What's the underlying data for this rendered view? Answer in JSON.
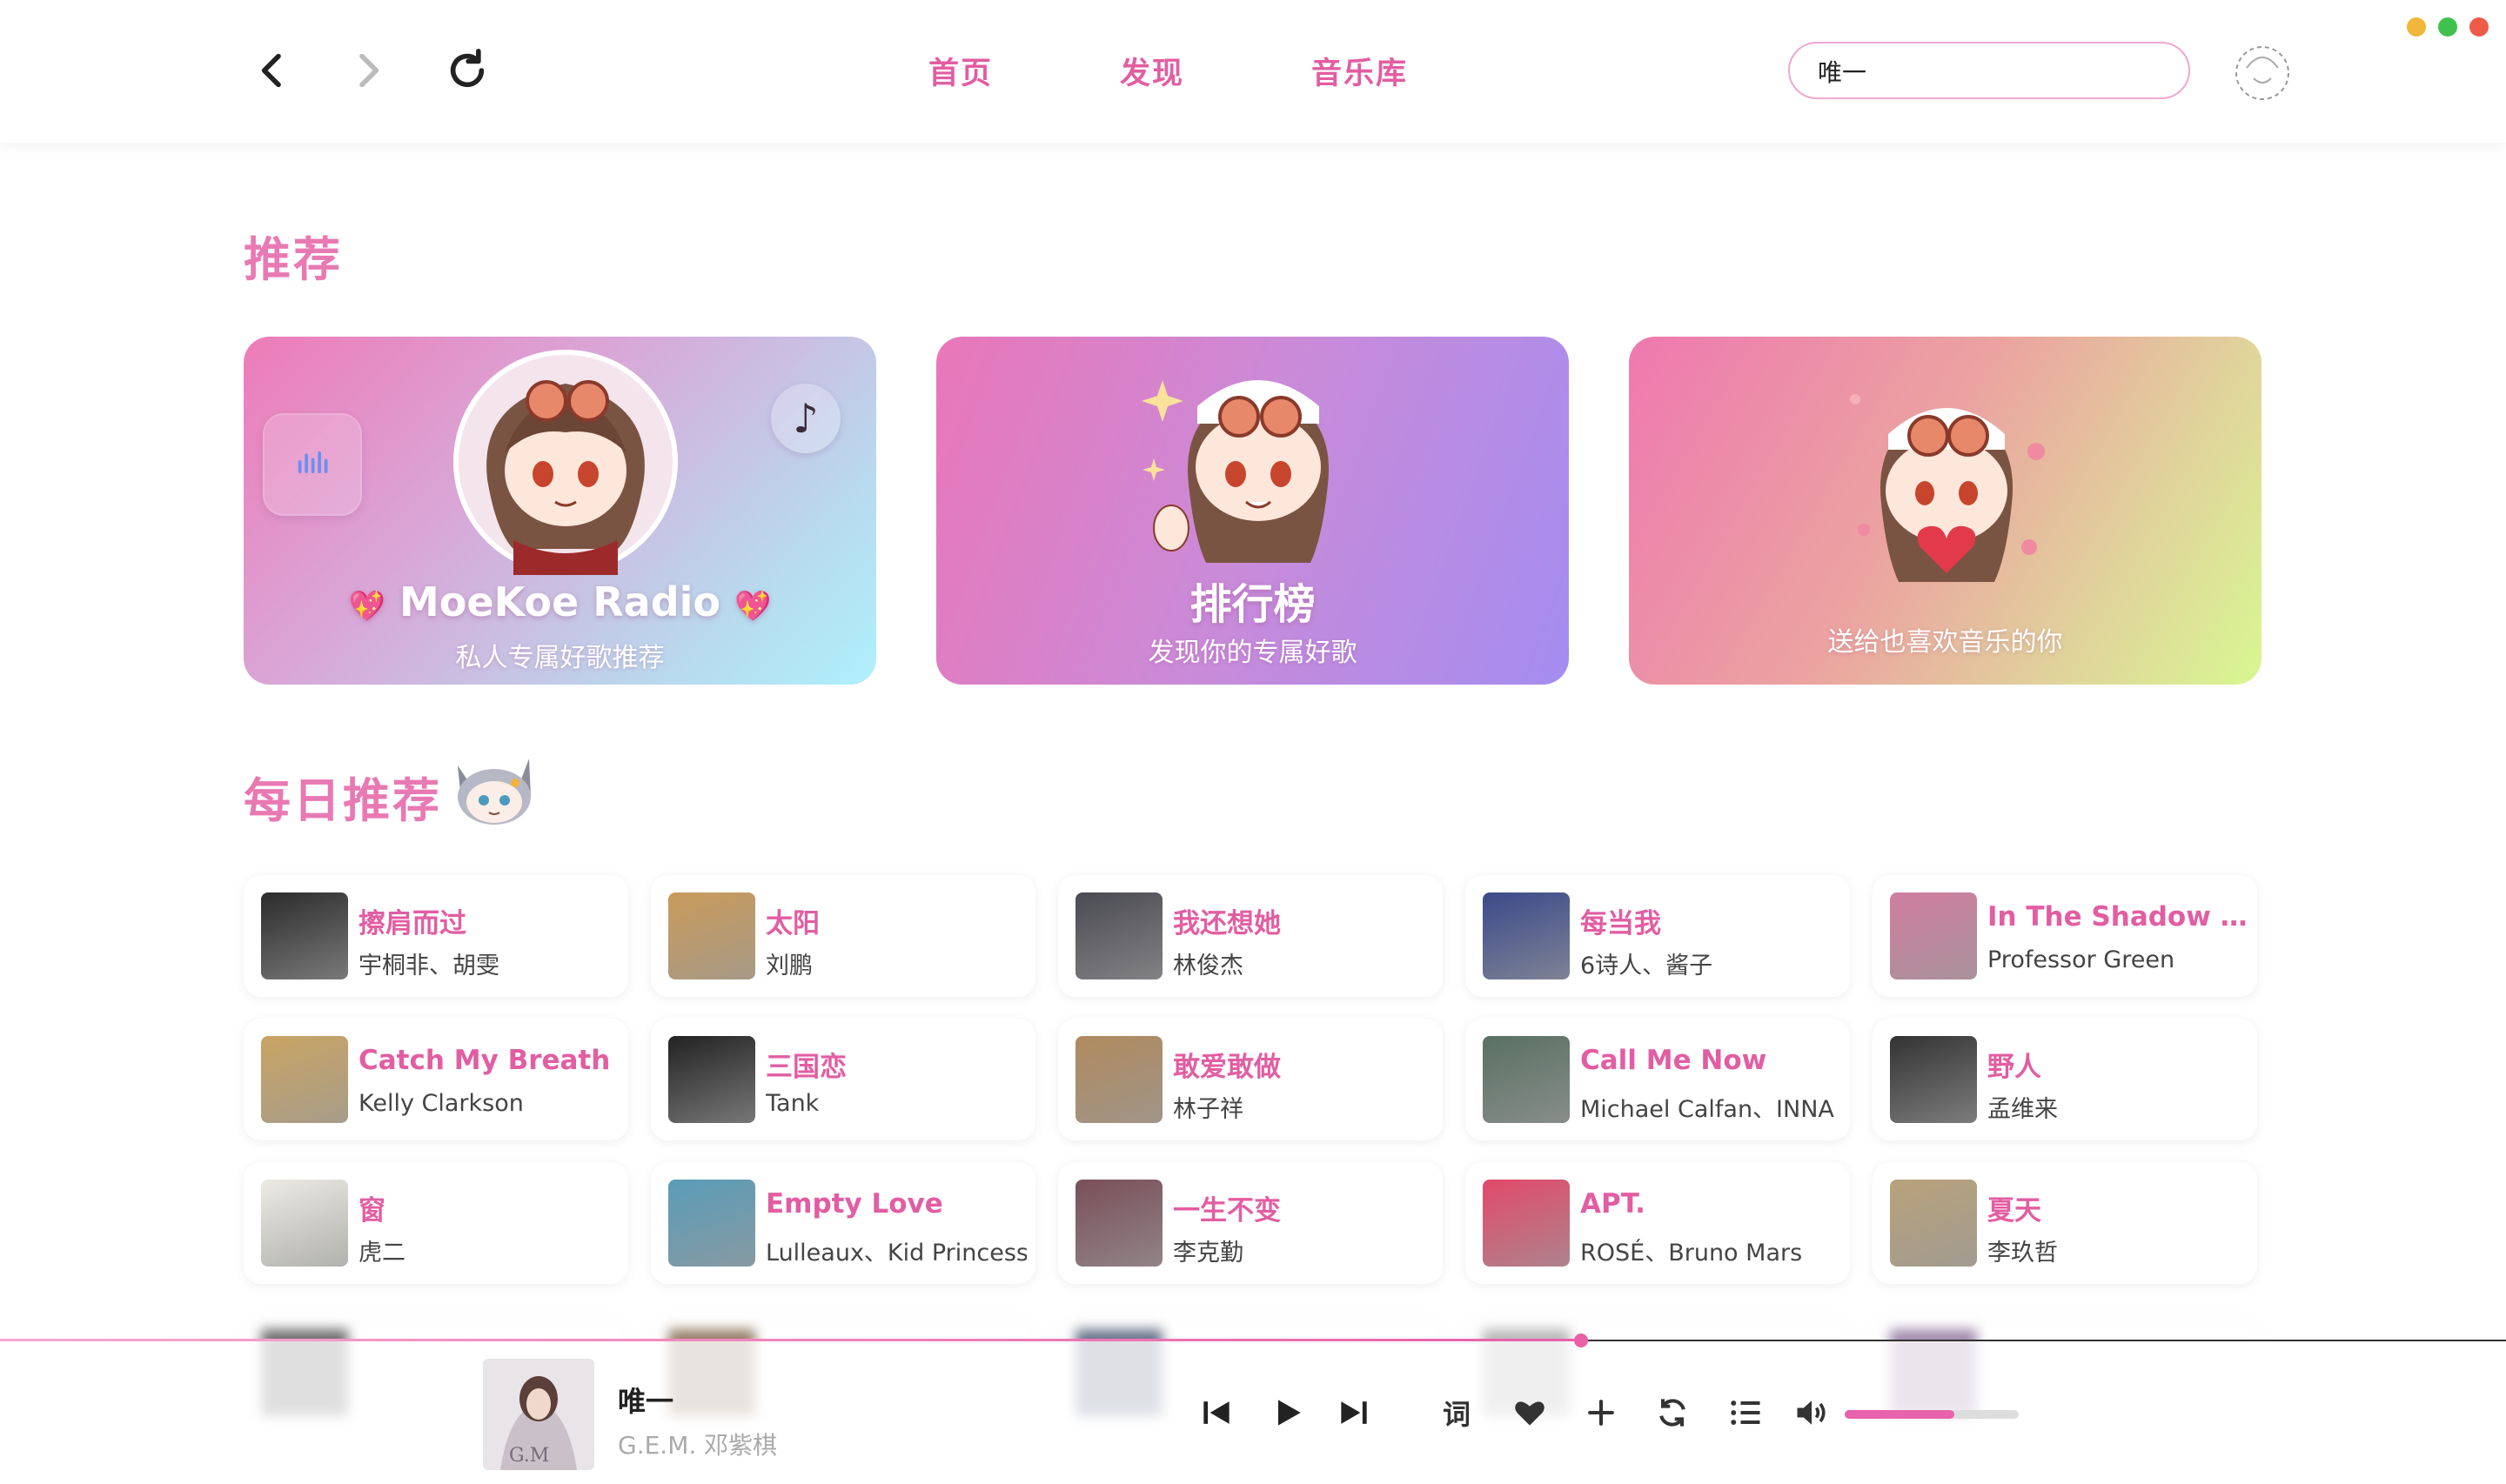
{
  "window": {
    "traffic_colors": [
      "#f1b63a",
      "#3ec24c",
      "#ee5b4a"
    ]
  },
  "nav": {
    "menu": [
      "首页",
      "发现",
      "音乐库"
    ],
    "search_value": "唯一"
  },
  "recommend": {
    "title": "推荐",
    "cards": [
      {
        "title": "MoeKoe Radio",
        "subtitle": "私人专属好歌推荐"
      },
      {
        "title": "排行榜",
        "subtitle": "发现你的专属好歌"
      },
      {
        "title": "",
        "subtitle": "送给也喜欢音乐的你"
      }
    ]
  },
  "daily": {
    "title": "每日推荐",
    "songs": [
      {
        "title": "擦肩而过",
        "artist": "宇桐非、胡雯",
        "cover": "#2b2b2b"
      },
      {
        "title": "太阳",
        "artist": "刘鹏",
        "cover": "#c99a5a"
      },
      {
        "title": "我还想她",
        "artist": "林俊杰",
        "cover": "#4a4a52"
      },
      {
        "title": "每当我",
        "artist": "6诗人、酱子",
        "cover": "#3b4a8a"
      },
      {
        "title": "In The Shadow O...",
        "artist": "Professor Green",
        "cover": "#d07ea0"
      },
      {
        "title": "Catch My Breath",
        "artist": "Kelly Clarkson",
        "cover": "#c9a463"
      },
      {
        "title": "三国恋",
        "artist": "Tank",
        "cover": "#222222"
      },
      {
        "title": "敢爱敢做",
        "artist": "林子祥",
        "cover": "#b08a5e"
      },
      {
        "title": "Call Me Now",
        "artist": "Michael Calfan、INNA",
        "cover": "#5a7064"
      },
      {
        "title": "野人",
        "artist": "孟维来",
        "cover": "#333333"
      },
      {
        "title": "窗",
        "artist": "虎二",
        "cover": "#ecebe3"
      },
      {
        "title": "Empty Love",
        "artist": "Lulleaux、Kid Princess",
        "cover": "#5a9cb8"
      },
      {
        "title": "一生不变",
        "artist": "李克勤",
        "cover": "#7a4f5a"
      },
      {
        "title": "APT.",
        "artist": "ROSÉ、Bruno Mars",
        "cover": "#e24a6a"
      },
      {
        "title": "夏天",
        "artist": "李玖哲",
        "cover": "#b8a27a"
      }
    ]
  },
  "player": {
    "title": "唯一",
    "artist": "G.E.M. 邓紫棋",
    "lyrics_label": "词",
    "progress": 0.631,
    "volume": 0.63
  }
}
